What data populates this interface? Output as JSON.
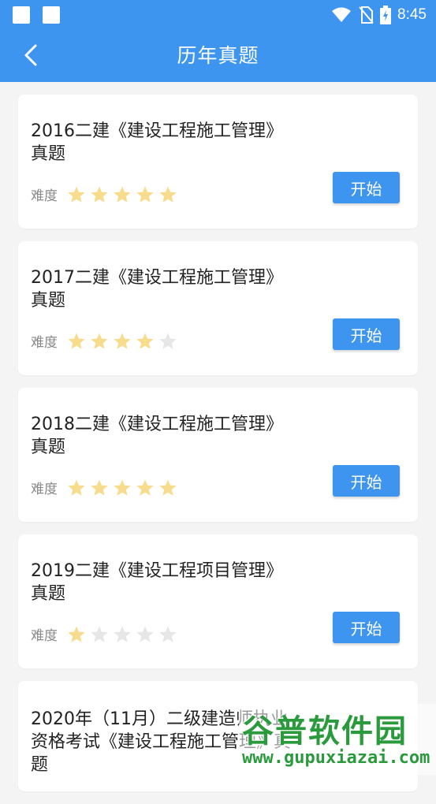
{
  "status_bar": {
    "time": "8:45",
    "icons": [
      "notification-square-icon",
      "notification-square-icon",
      "wifi-icon",
      "no-sim-icon",
      "battery-charging-icon"
    ]
  },
  "header": {
    "title": "历年真题",
    "back_icon": "chevron-left-icon"
  },
  "difficulty_label": "难度",
  "start_label": "开始",
  "colors": {
    "primary": "#3d95f0",
    "star_on": "#f7dc8d",
    "star_off": "#e6e6e6"
  },
  "papers": [
    {
      "title": "2016二建《建设工程施工管理》真题",
      "difficulty": 5,
      "max": 5
    },
    {
      "title": "2017二建《建设工程施工管理》真题",
      "difficulty": 4,
      "max": 5
    },
    {
      "title": "2018二建《建设工程施工管理》真题",
      "difficulty": 5,
      "max": 5
    },
    {
      "title": "2019二建《建设工程项目管理》真题",
      "difficulty": 1,
      "max": 5
    },
    {
      "title": "2020年（11月）二级建造师执业资格考试《建设工程施工管理》真题",
      "difficulty": null,
      "max": 5
    }
  ],
  "watermark": {
    "main": "谷普软件园",
    "sub": "www.gupuxiazai.com"
  }
}
